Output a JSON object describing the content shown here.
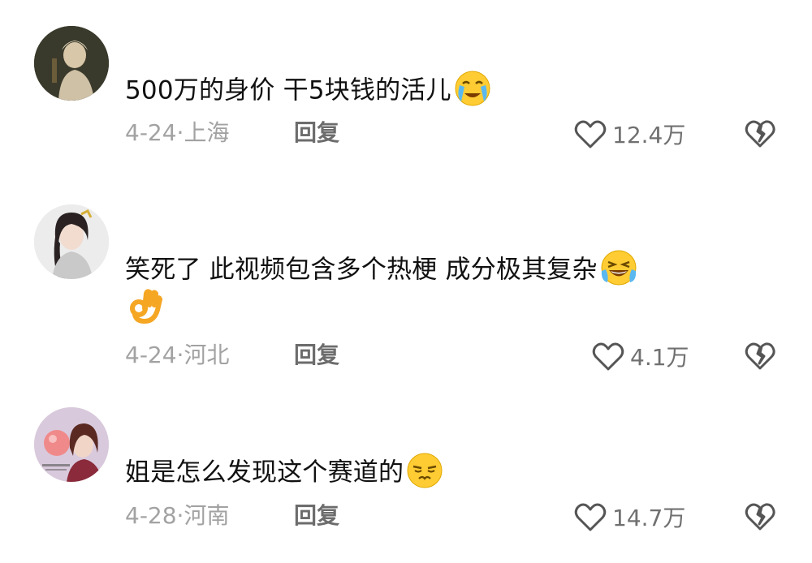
{
  "comments": [
    {
      "text": "500万的身价 干5块钱的活儿",
      "emoji": "crying-emoji",
      "date": "4-24·",
      "location": "上海",
      "reply_label": "回复",
      "likes": "12.4万",
      "avatar": "woman-portrait-dark"
    },
    {
      "text": "笑死了 此视频包含多个热梗 成分极其复杂",
      "emoji": "laughing-tears-emoji",
      "emoji2": "ok-hand-emoji",
      "date": "4-24·",
      "location": "河北",
      "reply_label": "回复",
      "likes": "4.1万",
      "avatar": "woman-portrait-light"
    },
    {
      "text": "姐是怎么发现这个赛道的",
      "emoji": "smirk-emoji",
      "date": "4-28·",
      "location": "河南",
      "reply_label": "回复",
      "likes": "14.7万",
      "avatar": "woman-with-bubble"
    }
  ],
  "colors": {
    "text": "#111111",
    "meta": "#a2a2a2",
    "reply": "#6c6c6c",
    "icon": "#555555"
  }
}
